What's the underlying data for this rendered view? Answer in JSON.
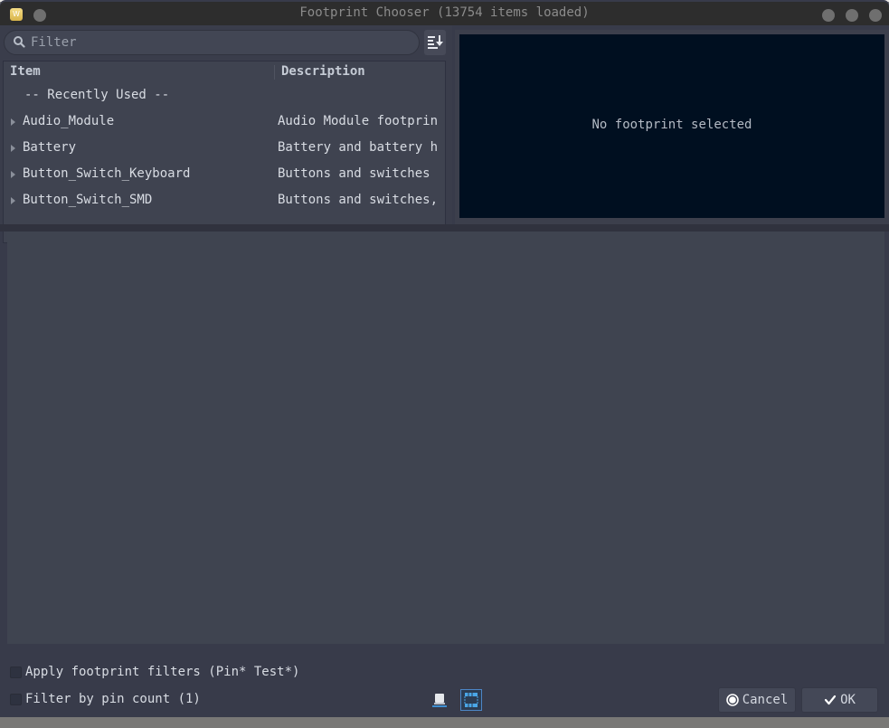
{
  "window": {
    "title": "Footprint Chooser (13754 items loaded)",
    "app_icon_letter": "W"
  },
  "filter": {
    "placeholder": "Filter",
    "value": ""
  },
  "tree": {
    "columns": [
      "Item",
      "Description"
    ],
    "section_label": "-- Recently Used --",
    "rows": [
      {
        "item": "Audio_Module",
        "description": "Audio Module footprin"
      },
      {
        "item": "Battery",
        "description": "Battery and battery h"
      },
      {
        "item": "Button_Switch_Keyboard",
        "description": "Buttons and switches "
      },
      {
        "item": "Button_Switch_SMD",
        "description": "Buttons and switches,"
      }
    ]
  },
  "preview": {
    "message": "No footprint selected"
  },
  "options": {
    "apply_filters_label": "Apply footprint filters (Pin* Test*)",
    "apply_filters_checked": false,
    "pin_count_label": "Filter by pin count (1)",
    "pin_count_checked": false
  },
  "buttons": {
    "cancel": "Cancel",
    "ok": "OK"
  },
  "colors": {
    "preview_bg": "#000f20",
    "active_toggle": "#4c86c6"
  }
}
